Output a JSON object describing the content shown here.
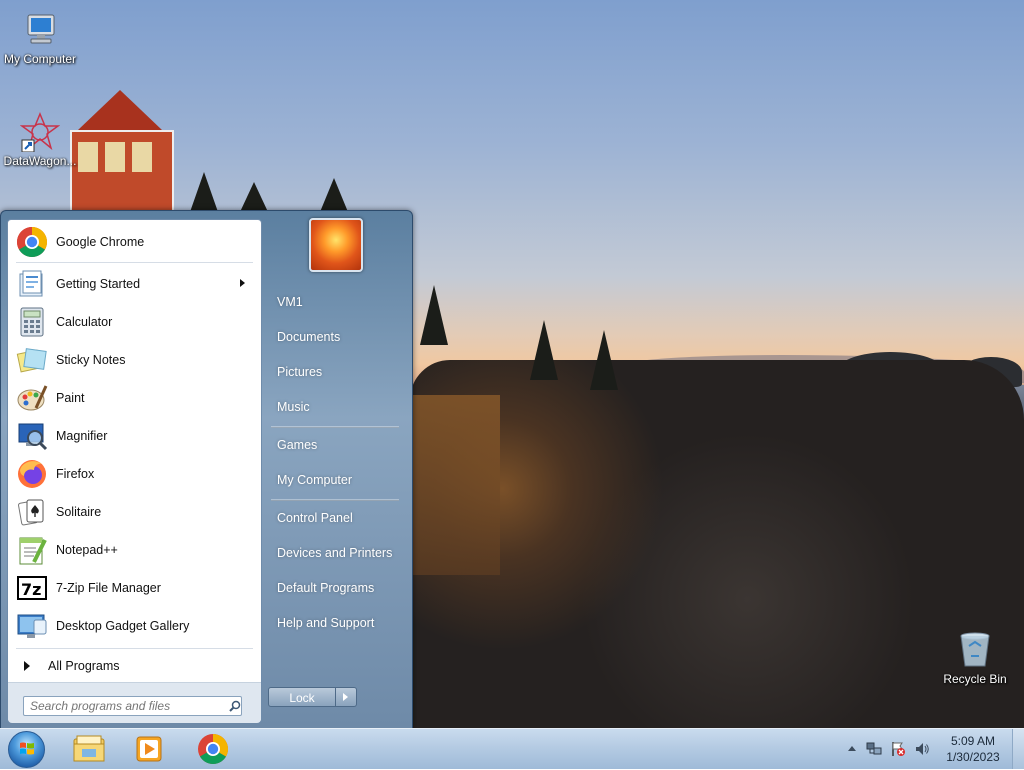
{
  "desktop": {
    "icons": [
      {
        "label": "My Computer"
      },
      {
        "label": "DataWagon..."
      },
      {
        "label": "Recycle Bin"
      }
    ]
  },
  "start_menu": {
    "pinned": [
      {
        "label": "Google Chrome",
        "icon": "chrome-icon"
      }
    ],
    "recent": [
      {
        "label": "Getting Started",
        "icon": "getting-started-icon",
        "submenu": true
      },
      {
        "label": "Calculator",
        "icon": "calculator-icon"
      },
      {
        "label": "Sticky Notes",
        "icon": "sticky-notes-icon"
      },
      {
        "label": "Paint",
        "icon": "paint-icon"
      },
      {
        "label": "Magnifier",
        "icon": "magnifier-icon"
      },
      {
        "label": "Firefox",
        "icon": "firefox-icon"
      },
      {
        "label": "Solitaire",
        "icon": "solitaire-icon"
      },
      {
        "label": "Notepad++",
        "icon": "notepadpp-icon"
      },
      {
        "label": "7-Zip File Manager",
        "icon": "7zip-icon"
      },
      {
        "label": "Desktop Gadget Gallery",
        "icon": "gadget-gallery-icon"
      }
    ],
    "all_programs_label": "All Programs",
    "search_placeholder": "Search programs and files",
    "right_items": [
      {
        "label": "VM1"
      },
      {
        "label": "Documents"
      },
      {
        "label": "Pictures"
      },
      {
        "label": "Music"
      },
      {
        "label": "Games"
      },
      {
        "label": "My Computer"
      },
      {
        "label": "Control Panel"
      },
      {
        "label": "Devices and Printers"
      },
      {
        "label": "Default Programs"
      },
      {
        "label": "Help and Support"
      }
    ],
    "power_button_label": "Lock"
  },
  "taskbar": {
    "pinned": [
      "explorer-icon",
      "media-player-icon",
      "chrome-icon"
    ],
    "clock_time": "5:09 AM",
    "clock_date": "1/30/2023"
  },
  "colors": {
    "start_menu_frame": "#6e8aa8",
    "taskbar": "#b5cbe3",
    "accent": "#1f5ea8"
  }
}
